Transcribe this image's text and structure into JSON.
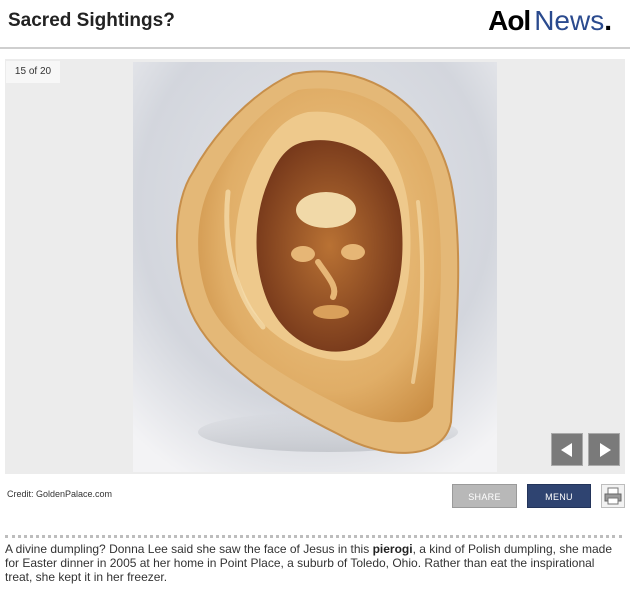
{
  "header": {
    "title": "Sacred Sightings?",
    "logo_aol": "Aol",
    "logo_news": "News",
    "logo_dot": "."
  },
  "slideshow": {
    "counter": "15 of 20",
    "credit": "Credit: GoldenPalace.com",
    "share_label": "SHARE",
    "menu_label": "MENU"
  },
  "caption": {
    "before": "A divine dumpling? Donna Lee said she saw the face of Jesus in this ",
    "bold": "pierogi",
    "after": ", a kind of Polish dumpling, she made for Easter dinner in 2005 at her home in Point Place, a suburb of Toledo, Ohio. Rather than eat the inspirational treat, she kept it in her freezer."
  },
  "colors": {
    "brand_blue": "#2a4a8e",
    "menu_button": "#2f4471",
    "share_button": "#b8b8b8",
    "nav_button": "#7a7a7a"
  },
  "icons": {
    "prev": "arrow-left-icon",
    "next": "arrow-right-icon",
    "print": "printer-icon"
  }
}
